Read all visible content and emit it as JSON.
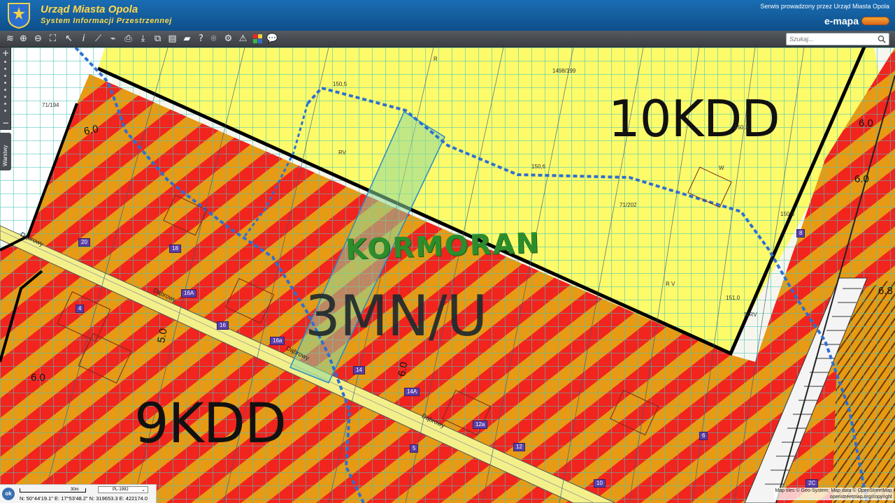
{
  "header": {
    "title": "Urząd Miasta Opola",
    "subtitle": "System Informacji Przestrzennej",
    "service_note": "Serwis prowadzony przez Urząd Miasta Opola",
    "brand": "e-mapa"
  },
  "toolbar": {
    "tools": [
      "layers",
      "zoom-in",
      "zoom-out",
      "zoom-extent",
      "select",
      "info",
      "measure-distance",
      "measure-area",
      "print",
      "download",
      "pan",
      "window",
      "table",
      "chat",
      "help",
      "location",
      "settings",
      "warning",
      "legend",
      "comment"
    ],
    "search_placeholder": "Szukaj..."
  },
  "map": {
    "zones": {
      "zone_10kdd": "10KDD",
      "zone_9kdd": "9KDD",
      "zone_3mnu": "3MN/U",
      "kormoran": "KORMORAN"
    },
    "streets": [
      "Dąbrowy",
      "Dąbrowy",
      "Dąbrowy",
      "Dąbrowy"
    ],
    "plot_numbers": [
      "20",
      "18",
      "16A",
      "16",
      "16a",
      "14",
      "14A",
      "12a",
      "12",
      "10",
      "5",
      "6",
      "8",
      "2C",
      "4"
    ],
    "dimensions": [
      "6.0",
      "6.0",
      "6.0",
      "6.0",
      "5.0",
      "6.0",
      "6.8"
    ],
    "parcel_labels": [
      "1498/199",
      "71/194",
      "71/202",
      "R",
      "RV",
      "R V",
      "S/RV",
      "W",
      "150,5",
      "150,6",
      "150,3",
      "150,8",
      "151,0"
    ],
    "colors": {
      "residential_hatch_red": "#f2241e",
      "residential_hatch_orange": "#e79a14",
      "agricultural_yellow": "#fdfb6a",
      "grid_cyan": "#47c5b8",
      "boundary_black": "#000000",
      "route_blue": "#2f6fd0",
      "highlight_green": "#8fd89a"
    }
  },
  "zoom_rail": {
    "plus": "+",
    "minus": "−",
    "layers_tab": "Warstwy"
  },
  "status": {
    "ok": "ok",
    "scale": "30m",
    "crs": "PL-1992",
    "coords": "N: 50°44'19.1\"  E: 17°53'48.2\"  N: 319653.3  E: 422174.0"
  },
  "attribution": {
    "line1": "Map tiles © Geo-System; Map data © OpenStreetMap",
    "line2": "openstreetmap.org/copyright"
  }
}
